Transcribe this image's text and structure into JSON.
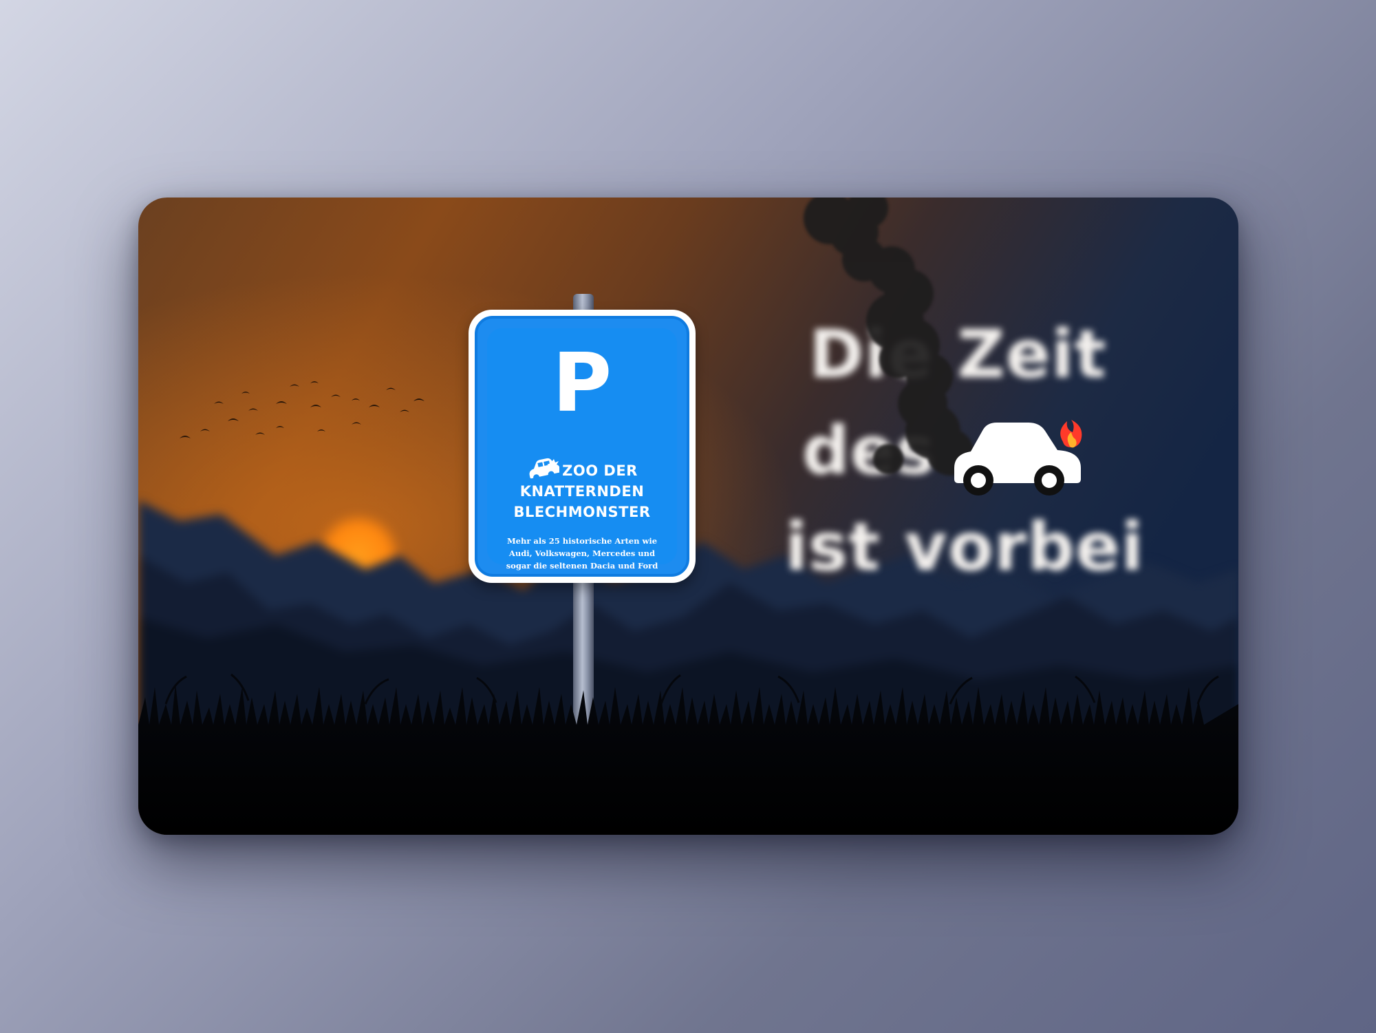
{
  "sign": {
    "letter": "P",
    "title_line1": "ZOO DER",
    "title_line2": "KNATTERNDEN",
    "title_line3": "BLECHMONSTER",
    "text_line1": "Mehr als 25 historische Arten wie",
    "text_line2": "Audi, Volkswagen, Mercedes und",
    "text_line3": "sogar die seltenen Dacia und Ford",
    "icon": "car-crash-icon",
    "color": "#168df2"
  },
  "headline": {
    "line1": "Die Zeit",
    "line2": "des",
    "line3": "ist vorbei",
    "icon": "burning-car-icon"
  },
  "colors": {
    "sky_warm": "#a65a1a",
    "sky_cool": "#16284a",
    "sun": "#ff8a10"
  }
}
